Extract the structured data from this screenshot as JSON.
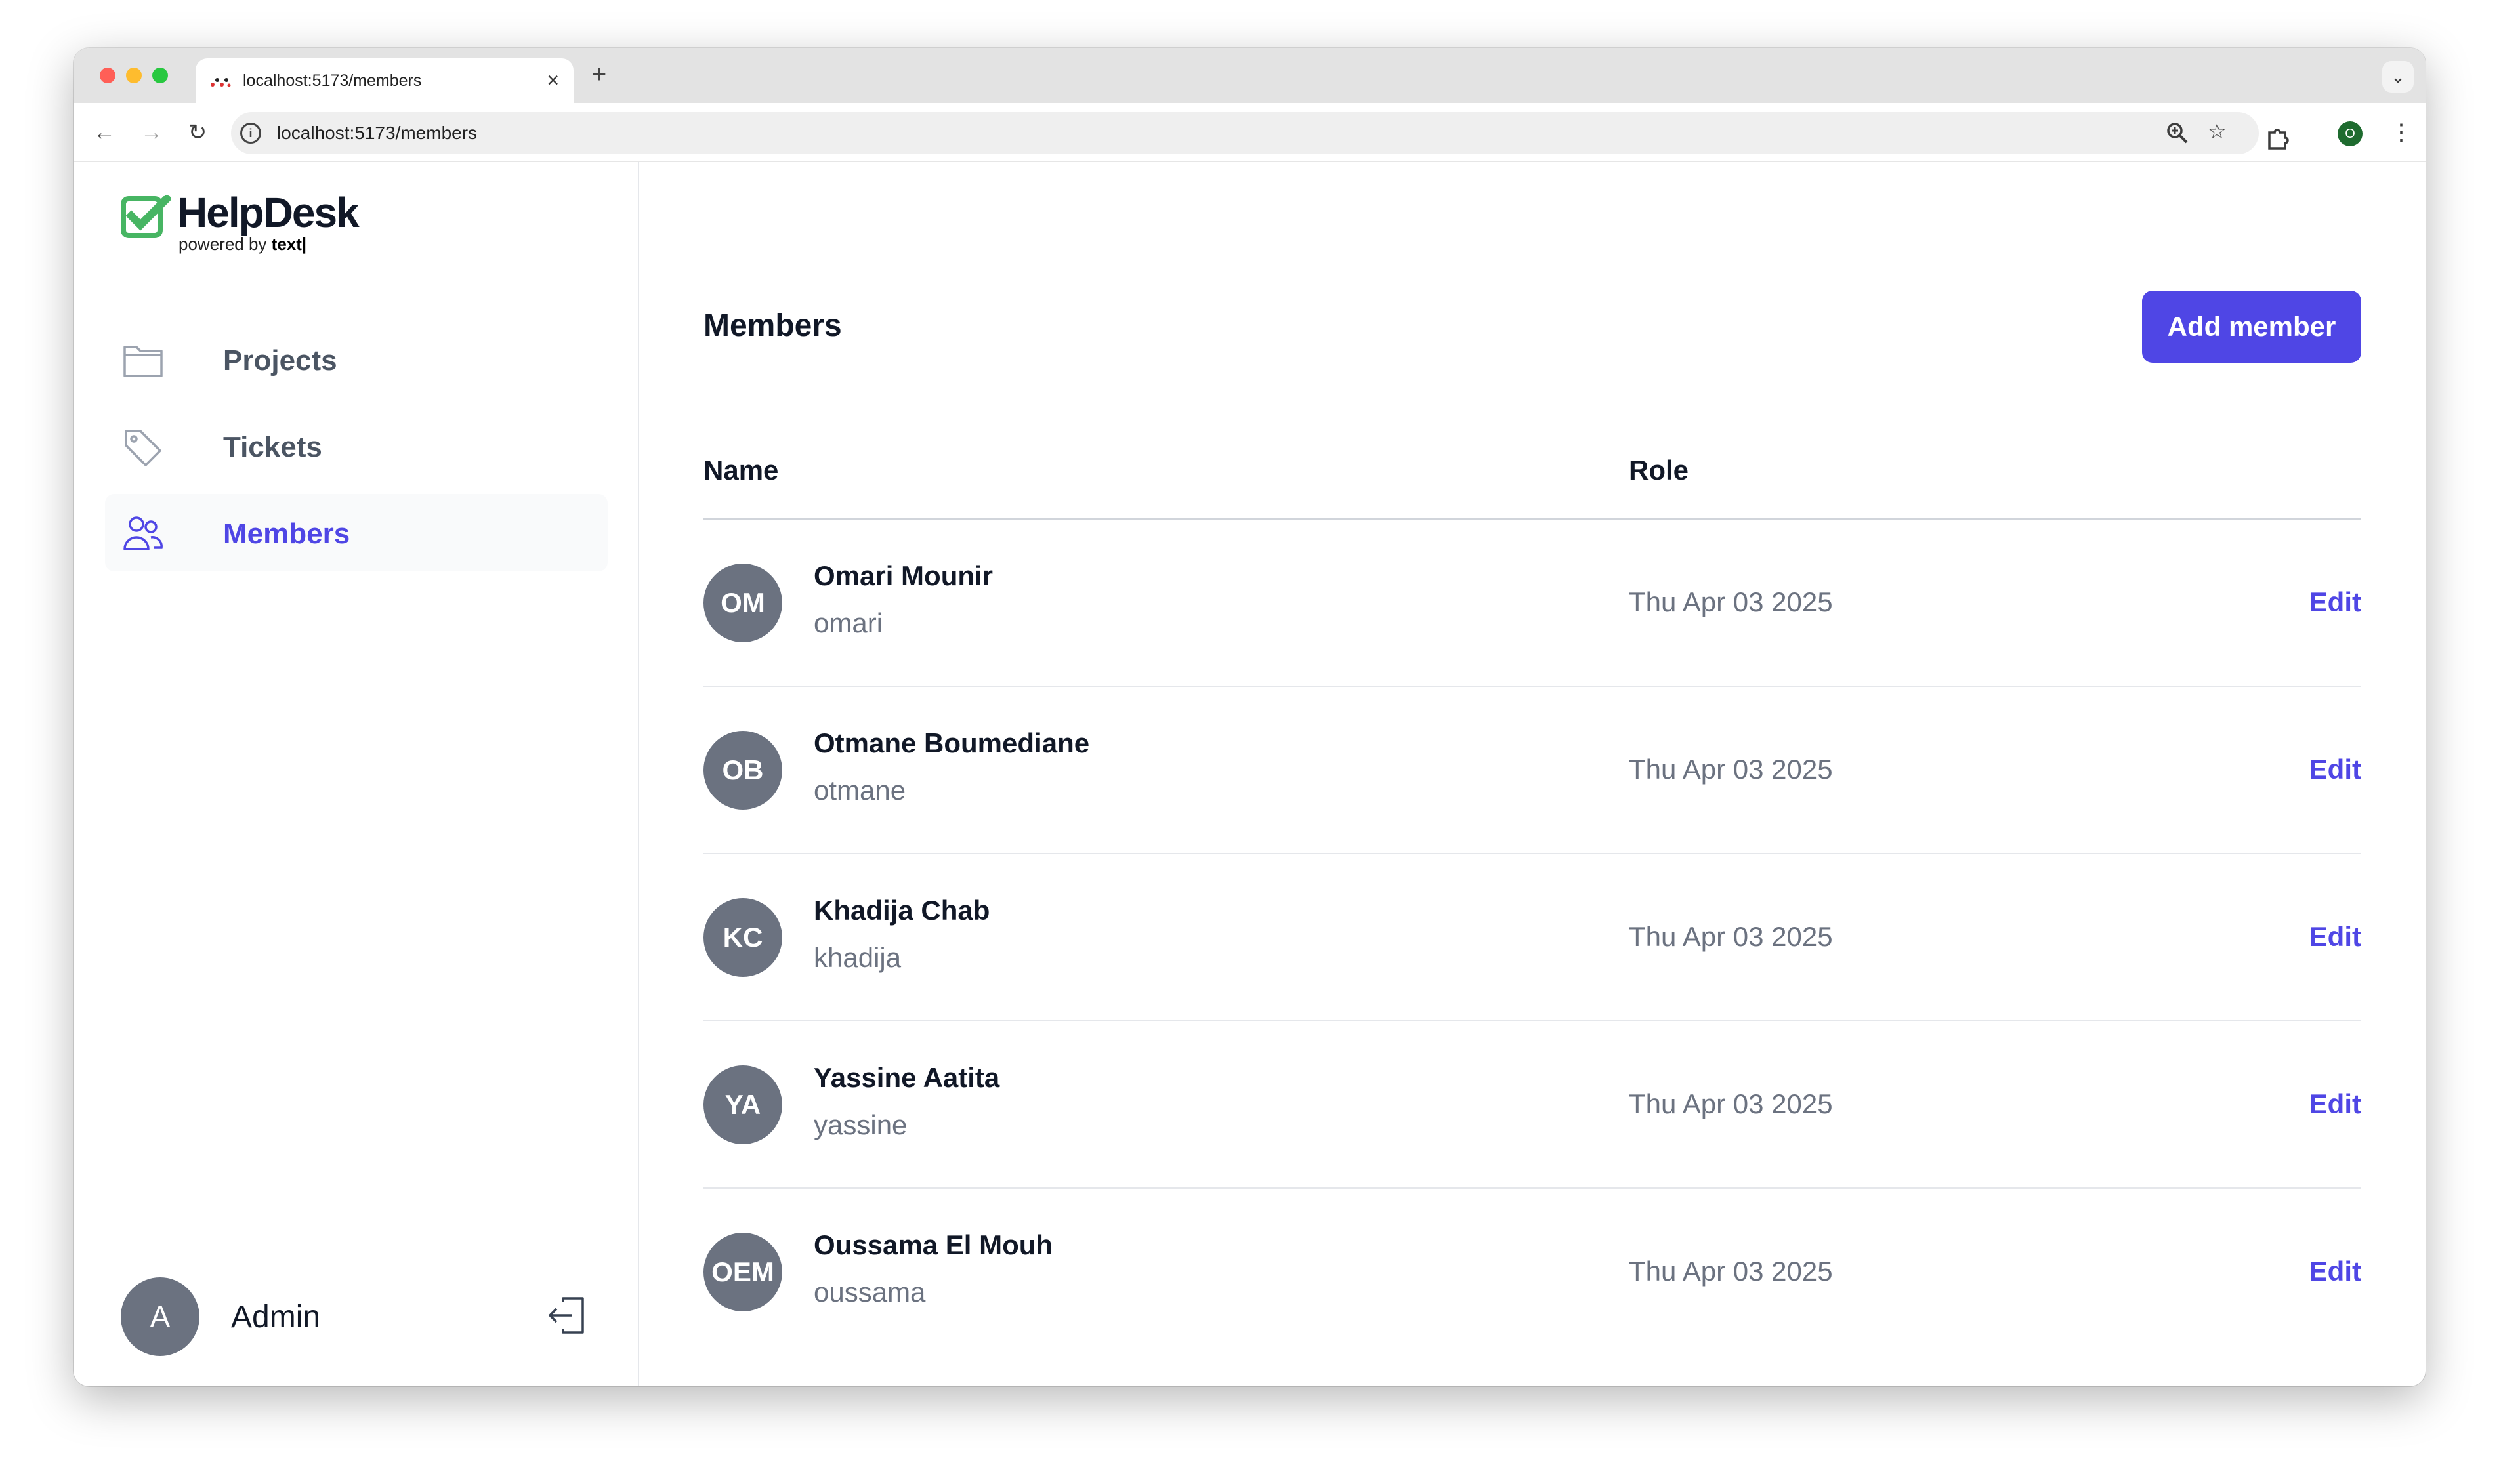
{
  "browser": {
    "tab_title": "localhost:5173/members",
    "url": "localhost:5173/members",
    "profile_initial": "O"
  },
  "app": {
    "logo_name": "HelpDesk",
    "logo_powered_prefix": "powered by ",
    "logo_powered_brand": "text|",
    "brand_color": "#4f46e5",
    "logo_color": "#47b563"
  },
  "sidebar": {
    "items": [
      {
        "label": "Projects",
        "icon": "folder-icon",
        "active": false
      },
      {
        "label": "Tickets",
        "icon": "tag-icon",
        "active": false
      },
      {
        "label": "Members",
        "icon": "users-icon",
        "active": true
      }
    ],
    "user": {
      "initial": "A",
      "name": "Admin"
    }
  },
  "main": {
    "title": "Members",
    "add_button": "Add member",
    "columns": [
      "Name",
      "Role"
    ],
    "members": [
      {
        "initials": "OM",
        "name": "Omari Mounir",
        "username": "omari",
        "date": "Thu Apr 03 2025",
        "action": "Edit"
      },
      {
        "initials": "OB",
        "name": "Otmane Boumediane",
        "username": "otmane",
        "date": "Thu Apr 03 2025",
        "action": "Edit"
      },
      {
        "initials": "KC",
        "name": "Khadija Chab",
        "username": "khadija",
        "date": "Thu Apr 03 2025",
        "action": "Edit"
      },
      {
        "initials": "YA",
        "name": "Yassine Aatita",
        "username": "yassine",
        "date": "Thu Apr 03 2025",
        "action": "Edit"
      },
      {
        "initials": "OEM",
        "name": "Oussama El Mouh",
        "username": "oussama",
        "date": "Thu Apr 03 2025",
        "action": "Edit"
      }
    ]
  }
}
